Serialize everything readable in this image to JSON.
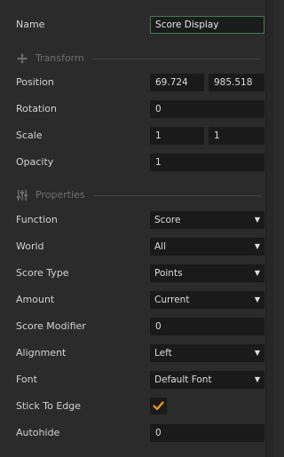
{
  "name": {
    "label": "Name",
    "value": "Score Display"
  },
  "transform": {
    "title": "Transform",
    "position": {
      "label": "Position",
      "x": "69.724",
      "y": "985.518"
    },
    "rotation": {
      "label": "Rotation",
      "value": "0"
    },
    "scale": {
      "label": "Scale",
      "x": "1",
      "y": "1"
    },
    "opacity": {
      "label": "Opacity",
      "value": "1"
    }
  },
  "properties": {
    "title": "Properties",
    "function": {
      "label": "Function",
      "value": "Score"
    },
    "world": {
      "label": "World",
      "value": "All"
    },
    "score_type": {
      "label": "Score Type",
      "value": "Points"
    },
    "amount": {
      "label": "Amount",
      "value": "Current"
    },
    "score_modifier": {
      "label": "Score Modifier",
      "value": "0"
    },
    "alignment": {
      "label": "Alignment",
      "value": "Left"
    },
    "font": {
      "label": "Font",
      "value": "Default Font"
    },
    "stick_to_edge": {
      "label": "Stick To Edge",
      "checked": true
    },
    "autohide": {
      "label": "Autohide",
      "value": "0"
    }
  },
  "icons": {
    "transform": "transform-icon",
    "properties": "sliders-icon",
    "dropdown": "chevron-down-icon",
    "check": "check-icon"
  },
  "colors": {
    "check": "#f0a020",
    "name_border": "#3f7a55"
  }
}
